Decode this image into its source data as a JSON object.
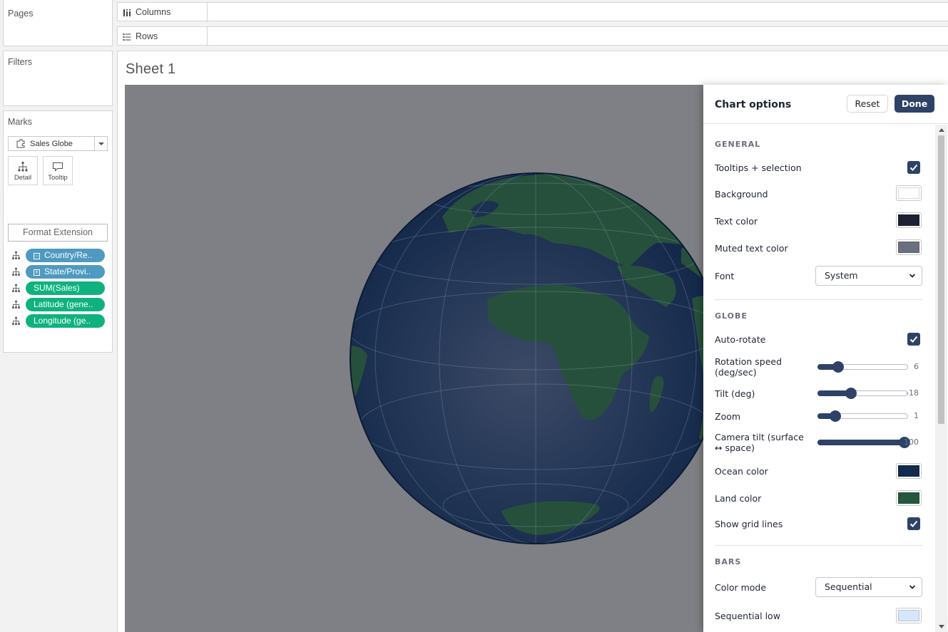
{
  "left_panel": {
    "pages_title": "Pages",
    "filters_title": "Filters",
    "marks_title": "Marks",
    "mark_type": "Sales Globe",
    "detail_label": "Detail",
    "tooltip_label": "Tooltip",
    "format_extension_label": "Format Extension",
    "fields": [
      {
        "label": "Country/Re..",
        "kind": "dimension",
        "toggle": "−"
      },
      {
        "label": "State/Provi..",
        "kind": "dimension",
        "toggle": "+"
      },
      {
        "label": "SUM(Sales)",
        "kind": "measure"
      },
      {
        "label": "Latitude (gene..",
        "kind": "measure"
      },
      {
        "label": "Longitude (ge..",
        "kind": "measure"
      }
    ]
  },
  "shelves": {
    "columns_label": "Columns",
    "rows_label": "Rows"
  },
  "sheet": {
    "title": "Sheet 1"
  },
  "chart_options": {
    "title": "Chart options",
    "reset_label": "Reset",
    "done_label": "Done",
    "general": {
      "heading": "GENERAL",
      "tooltips_label": "Tooltips + selection",
      "tooltips_checked": true,
      "background_label": "Background",
      "background_color": "#ffffff",
      "text_color_label": "Text color",
      "text_color": "#1c2233",
      "muted_text_label": "Muted text color",
      "muted_text_color": "#6b7080",
      "font_label": "Font",
      "font_value": "System"
    },
    "globe": {
      "heading": "GLOBE",
      "auto_rotate_label": "Auto-rotate",
      "auto_rotate_checked": true,
      "rotation_speed_label": "Rotation speed (deg/sec)",
      "rotation_speed_value": "6",
      "rotation_speed_fraction": 0.23,
      "tilt_label": "Tilt (deg)",
      "tilt_value": "-18",
      "tilt_fraction": 0.37,
      "zoom_label": "Zoom",
      "zoom_value": "1",
      "zoom_fraction": 0.2,
      "camera_tilt_label": "Camera tilt (surface ↔ space)",
      "camera_tilt_value": "100",
      "camera_tilt_fraction": 0.96,
      "ocean_label": "Ocean color",
      "ocean_color": "#122a4e",
      "land_label": "Land color",
      "land_color": "#25573f",
      "grid_label": "Show grid lines",
      "grid_checked": true
    },
    "bars": {
      "heading": "BARS",
      "color_mode_label": "Color mode",
      "color_mode_value": "Sequential",
      "seq_low_label": "Sequential low",
      "seq_low_color": "#d6e6fb"
    }
  },
  "colors": {
    "viz_background": "#7f8085",
    "accent": "#2d4266",
    "dimension_pill": "#4e9ac0",
    "measure_pill": "#0fb27e"
  }
}
